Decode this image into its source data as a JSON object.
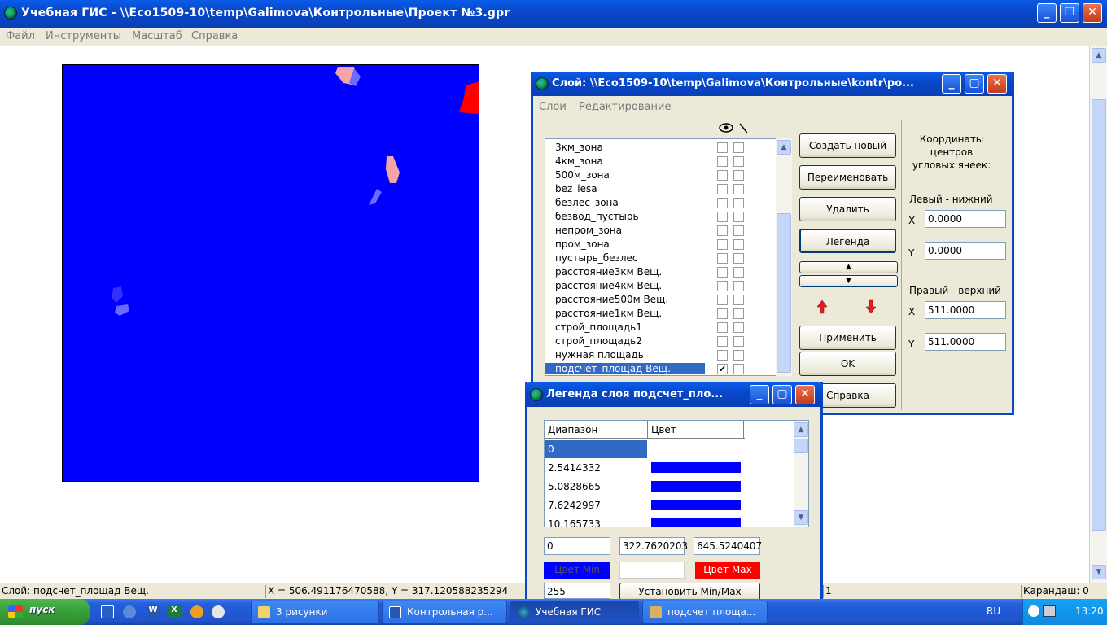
{
  "main_window": {
    "title": "Учебная ГИС - \\\\Eco1509-10\\temp\\Galimova\\Контрольные\\Проект №3.gpr",
    "menu": [
      "Файл",
      "Инструменты",
      "Масштаб",
      "Справка"
    ]
  },
  "status_bar": {
    "layer": "Слой: подсчет_площад  Вещ.",
    "coords": "X = 506.491176470588, Y = 317.120588235294",
    "value": "1",
    "tool": "Карандаш: 0"
  },
  "layer_dialog": {
    "title": "Слой: \\\\Eco1509-10\\temp\\Galimova\\Контрольные\\kontr\\ро...",
    "menu": [
      "Слои",
      "Редактирование"
    ],
    "layers": [
      {
        "name": "3км_зона",
        "visible": false,
        "edit": false
      },
      {
        "name": "4км_зона",
        "visible": false,
        "edit": false
      },
      {
        "name": "500м_зона",
        "visible": false,
        "edit": false
      },
      {
        "name": "bez_lesa",
        "visible": false,
        "edit": false
      },
      {
        "name": "безлес_зона",
        "visible": false,
        "edit": false
      },
      {
        "name": "безвод_пустырь",
        "visible": false,
        "edit": false
      },
      {
        "name": "непром_зона",
        "visible": false,
        "edit": false
      },
      {
        "name": "пром_зона",
        "visible": false,
        "edit": false
      },
      {
        "name": "пустырь_безлес",
        "visible": false,
        "edit": false
      },
      {
        "name": "расстояние3км Вещ.",
        "visible": false,
        "edit": false
      },
      {
        "name": "расстояние4км Вещ.",
        "visible": false,
        "edit": false
      },
      {
        "name": "расстояние500м Вещ.",
        "visible": false,
        "edit": false
      },
      {
        "name": "расстояние1км Вещ.",
        "visible": false,
        "edit": false
      },
      {
        "name": "строй_площадь1",
        "visible": false,
        "edit": false
      },
      {
        "name": "строй_площадь2",
        "visible": false,
        "edit": false
      },
      {
        "name": "нужная площадь",
        "visible": false,
        "edit": false
      },
      {
        "name": "подсчет_площад Вещ.",
        "visible": true,
        "edit": false,
        "selected": true
      }
    ],
    "buttons": {
      "create": "Создать новый",
      "rename": "Переименовать",
      "delete": "Удалить",
      "legend": "Легенда",
      "apply": "Применить",
      "ok": "OK",
      "help": "Справка"
    },
    "coords": {
      "heading": "Координаты центров угловых ячеек:",
      "lower_left": "Левый - нижний",
      "upper_right": "Правый - верхний",
      "x_label": "X",
      "y_label": "Y",
      "ll_x": "0.0000",
      "ll_y": "0.0000",
      "ur_x": "511.0000",
      "ur_y": "511.0000"
    }
  },
  "legend_dialog": {
    "title": "Легенда слоя подсчет_пло...",
    "columns": [
      "Диапазон",
      "Цвет"
    ],
    "rows": [
      {
        "range": "0",
        "color": "#ffffff",
        "selected": true
      },
      {
        "range": "2.5414332",
        "color": "#0000ff"
      },
      {
        "range": "5.0828665",
        "color": "#0000ff"
      },
      {
        "range": "7.6242997",
        "color": "#0000ff"
      },
      {
        "range": "10.165733",
        "color": "#0000ff"
      }
    ],
    "min_value": "0",
    "mid_value": "322.7620203",
    "max_value": "645.5240407",
    "color_min_label": "Цвет Min",
    "color_max_label": "Цвет Max",
    "color_min": "#0000ff",
    "color_max": "#ff0000",
    "steps": "255",
    "set_minmax": "Установить Min/Max"
  },
  "taskbar": {
    "start": "пуск",
    "tasks": [
      {
        "label": "3 рисунки",
        "icon": "folder-icon"
      },
      {
        "label": "Контрольная р...",
        "icon": "word-icon"
      },
      {
        "label": "Учебная ГИС",
        "icon": "gis-icon",
        "active": true
      },
      {
        "label": "подсчет площа...",
        "icon": "paint-icon"
      }
    ],
    "language": "RU",
    "clock": "13:20"
  },
  "colors": {
    "raster_blue": "#0000ff",
    "raster_pink": "#f4a6a6",
    "raster_red": "#ff0000",
    "raster_light_blue": "#6b6bff",
    "selection": "#316ac5"
  }
}
